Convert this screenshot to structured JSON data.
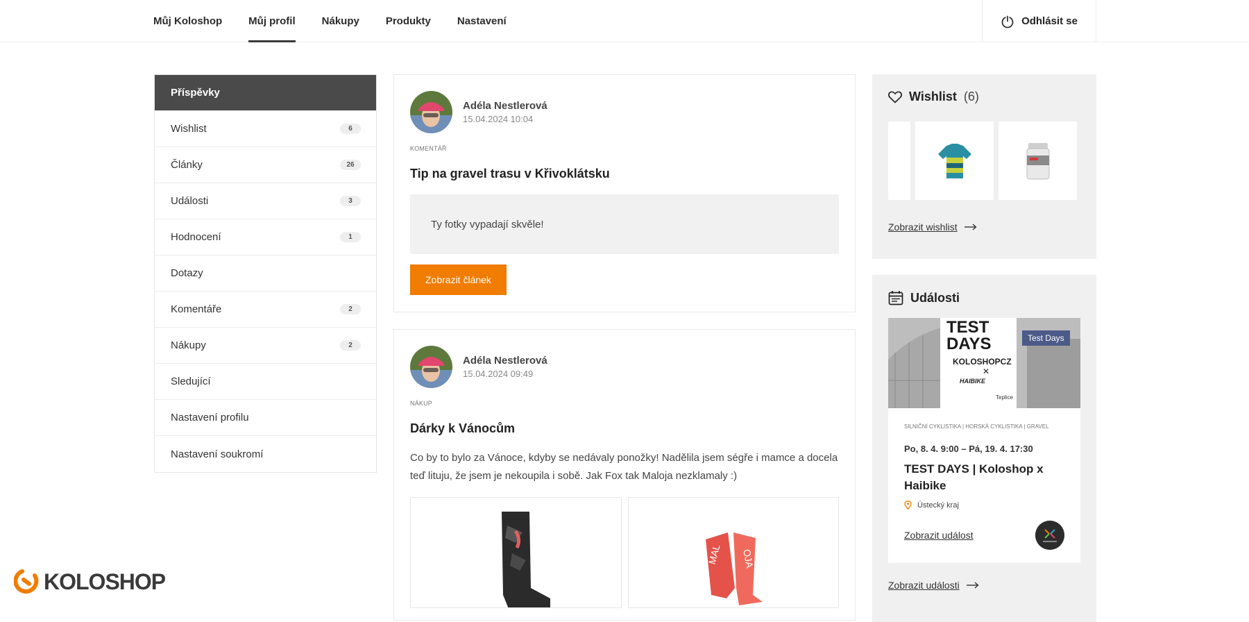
{
  "nav": {
    "tabs": [
      "Můj Koloshop",
      "Můj profil",
      "Nákupy",
      "Produkty",
      "Nastavení"
    ],
    "active_index": 1,
    "logout_label": "Odhlásit se"
  },
  "sidebar": {
    "items": [
      {
        "label": "Příspěvky",
        "count": ""
      },
      {
        "label": "Wishlist",
        "count": "6"
      },
      {
        "label": "Články",
        "count": "26"
      },
      {
        "label": "Události",
        "count": "3"
      },
      {
        "label": "Hodnocení",
        "count": "1"
      },
      {
        "label": "Dotazy",
        "count": ""
      },
      {
        "label": "Komentáře",
        "count": "2"
      },
      {
        "label": "Nákupy",
        "count": "2"
      },
      {
        "label": "Sledující",
        "count": ""
      },
      {
        "label": "Nastavení profilu",
        "count": ""
      },
      {
        "label": "Nastavení soukromí",
        "count": ""
      }
    ]
  },
  "posts": [
    {
      "author": "Adéla Nestlerová",
      "date": "15.04.2024 10:04",
      "kind": "KOMENTÁŘ",
      "title": "Tip na gravel trasu v Křivoklátsku",
      "quote": "Ty fotky vypadají skvěle!",
      "button": "Zobrazit článek"
    },
    {
      "author": "Adéla Nestlerová",
      "date": "15.04.2024 09:49",
      "kind": "NÁKUP",
      "title": "Dárky k Vánocům",
      "text": "Co by to bylo za Vánoce, kdyby se nedávaly ponožky! Nadělila jsem ségře i mamce a docela teď lituju, že jsem je nekoupila i sobě. Jak Fox tak Maloja nezklamaly :)"
    }
  ],
  "wishlist": {
    "title": "Wishlist",
    "count": "(6)",
    "link": "Zobrazit wishlist"
  },
  "events": {
    "title": "Události",
    "card": {
      "tag": "Test Days",
      "category": "SILNIČNÍ CYKLISTIKA | HORSKÁ CYKLISTIKA | GRAVEL",
      "date": "Po, 8. 4. 9:00 – Pá, 19. 4. 17:30",
      "title": "TEST DAYS | Koloshop x Haibike",
      "location": "Ústecký kraj",
      "link": "Zobrazit událost",
      "image_text": {
        "line1": "TEST",
        "line2": "DAYS",
        "brand": "KOLOSHOPCZ",
        "cross": "✕",
        "partner": "HAIBIKE",
        "city": "Teplice"
      }
    },
    "link": "Zobrazit události"
  },
  "logo": "KOLOSHOP",
  "colors": {
    "accent": "#f07c00",
    "sidebar_active": "#4a4a4a",
    "panel": "#f0f0f0",
    "tag": "#4c5a88"
  }
}
